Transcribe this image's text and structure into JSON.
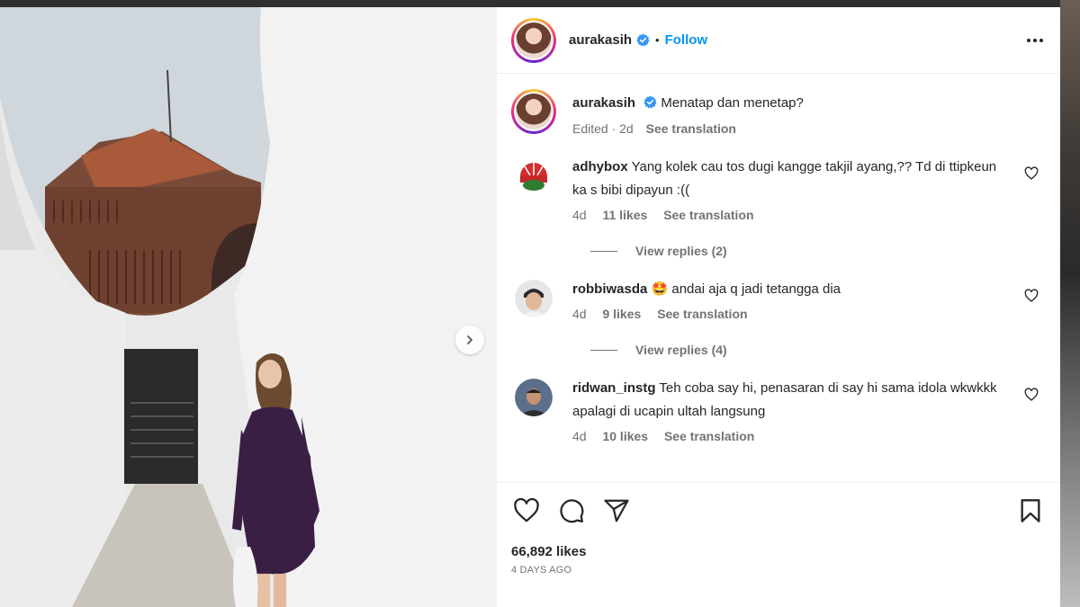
{
  "post": {
    "username": "aurakasih",
    "follow_label": "Follow",
    "dot": "•",
    "caption": {
      "username": "aurakasih",
      "text": "Menatap dan menetap?",
      "edited": "Edited · 2d",
      "see_translation": "See translation"
    },
    "comments": [
      {
        "username": "adhybox",
        "text": "Yang kolek cau tos dugi kangge takjil ayang,?? Td di ttipkeun ka s bibi dipayun :((",
        "age": "4d",
        "likes": "11 likes",
        "see_translation": "See translation",
        "view_replies": "View replies (2)"
      },
      {
        "username": "robbiwasda",
        "text": "🤩 andai aja q jadi tetangga dia",
        "age": "4d",
        "likes": "9 likes",
        "see_translation": "See translation",
        "view_replies": "View replies (4)"
      },
      {
        "username": "ridwan_instg",
        "text": "Teh coba say hi, penasaran di say hi sama idola wkwkkk apalagi di ucapin ultah langsung",
        "age": "4d",
        "likes": "10 likes",
        "see_translation": "See translation"
      }
    ],
    "likes_count": "66,892 likes",
    "posted": "4 DAYS AGO"
  },
  "icons": {
    "more": "more-options-icon",
    "verified": "verified-badge-icon",
    "like": "heart-icon",
    "comment": "comment-icon",
    "share": "share-icon",
    "save": "bookmark-icon",
    "next": "chevron-right-icon"
  },
  "colors": {
    "accent": "#0095f6",
    "verified": "#3897f0",
    "text": "#262626",
    "muted": "#737373",
    "dress": "#3a1f45"
  }
}
